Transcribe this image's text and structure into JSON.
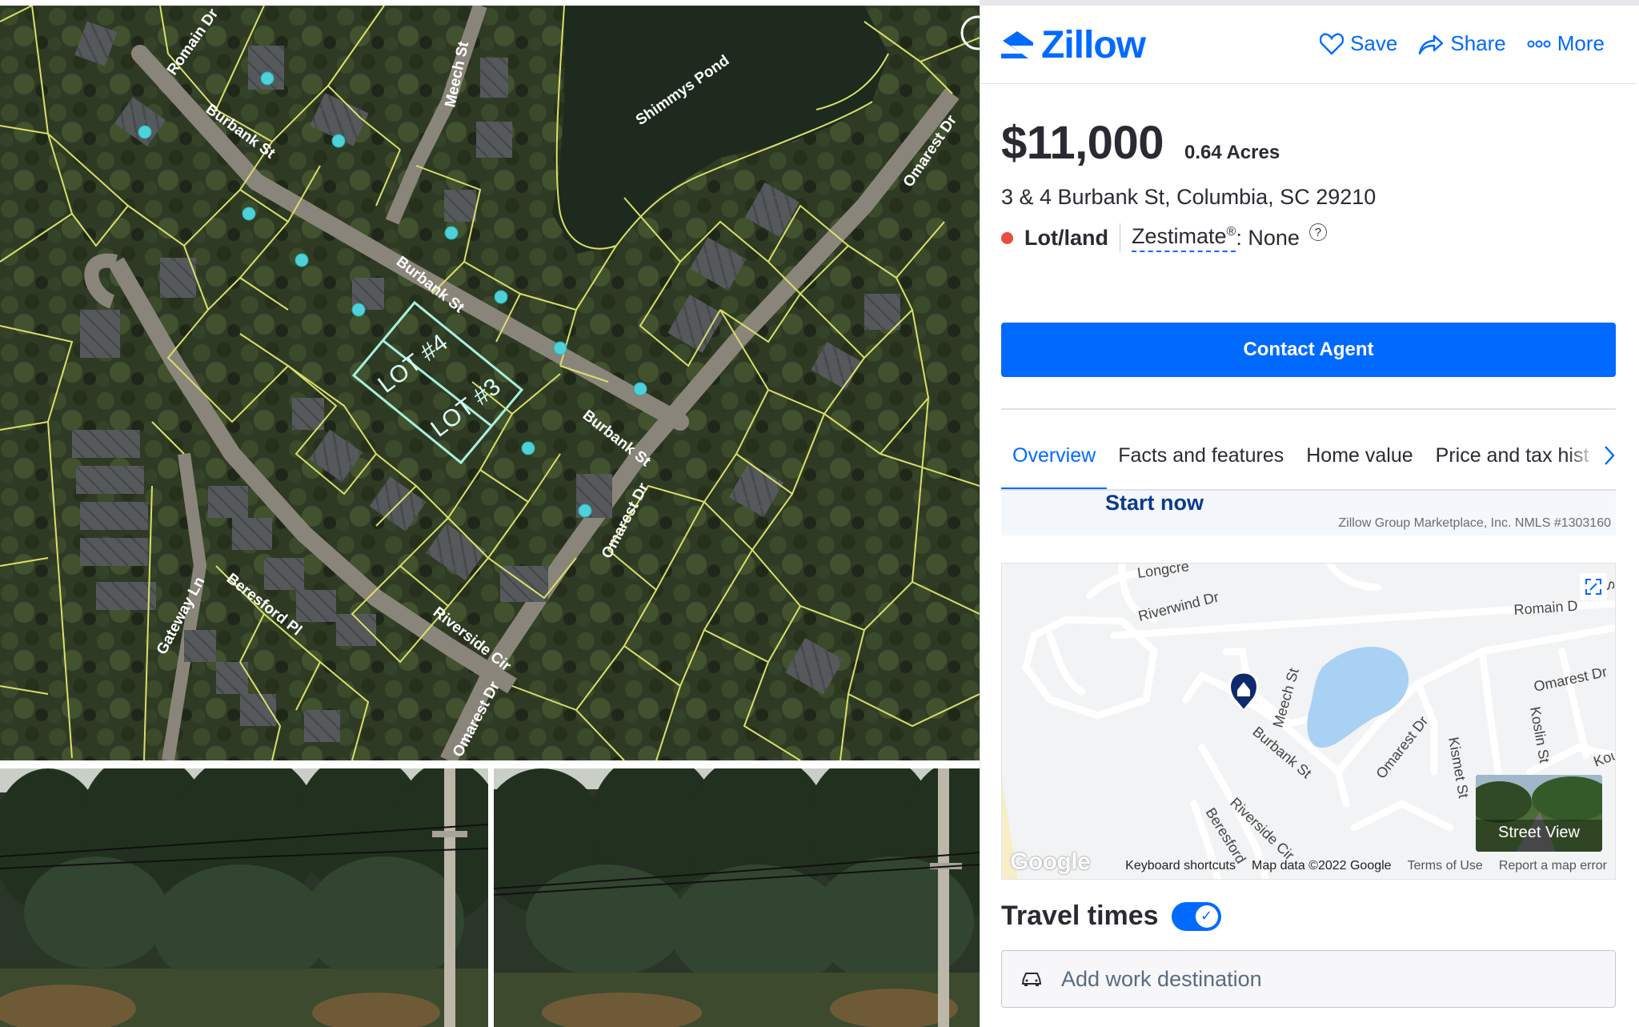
{
  "header": {
    "brand": "Zillow",
    "actions": [
      {
        "label": "Save",
        "icon": "heart-icon"
      },
      {
        "label": "Share",
        "icon": "share-icon"
      },
      {
        "label": "More",
        "icon": "more-icon"
      }
    ]
  },
  "listing": {
    "price": "$11,000",
    "lot_size": "0.64 Acres",
    "address": "3 & 4 Burbank St, Columbia, SC 29210",
    "status_type": "Lot/land",
    "zestimate_label": "Zestimate",
    "zestimate_mark": "®",
    "zestimate_value": ": None",
    "help": "?"
  },
  "contact": {
    "label": "Contact Agent"
  },
  "tabs": [
    {
      "label": "Overview",
      "active": true
    },
    {
      "label": "Facts and features",
      "active": false
    },
    {
      "label": "Home value",
      "active": false
    },
    {
      "label": "Price and tax hist",
      "active": false
    }
  ],
  "promo": {
    "cta": "Start now",
    "note": "Zillow Group Marketplace, Inc. NMLS #1303160"
  },
  "aerial_map": {
    "labels": {
      "shimmys_pond": "Shimmys Pond",
      "romain_dr": "Romain Dr",
      "meech_st": "Meech St",
      "burbank_st_1": "Burbank St",
      "burbank_st_2": "Burbank St",
      "burbank_st_3": "Burbank St",
      "omarest_dr_1": "Omarest Dr",
      "omarest_dr_2": "Omarest Dr",
      "omarest_dr_3": "Omarest Dr",
      "riverside_cir": "Riverside Cir",
      "beresford_pl": "Beresford Pl",
      "gateway_ln": "Gateway Ln",
      "lot_4": "LOT #4",
      "lot_3": "LOT #3"
    }
  },
  "google_map": {
    "streets": {
      "longcreek": "Longcre",
      "riverwind": "Riverwind Dr",
      "romain": "Romain D",
      "omarest1": "Omarest Dr",
      "omarest2": "Omarest Dr",
      "meech": "Meech St",
      "burbank": "Burbank St",
      "kismet": "Kismet St",
      "koslin": "Koslin St",
      "riverside": "Riverside Cir",
      "beresford": "Beresford",
      "koul": "Koul",
      "edge_s": "S"
    },
    "street_view": "Street View",
    "google": "Google",
    "footer": [
      "Keyboard shortcuts",
      "Map data ©2022 Google",
      "Terms of Use",
      "Report a map error"
    ]
  },
  "travel": {
    "title": "Travel times",
    "toggle_on": true,
    "input_placeholder": "Add work destination"
  },
  "colors": {
    "brand_blue": "#006aff",
    "status_red": "#ea4c3d",
    "parcel_lines": "#d8e06a",
    "lot_outline": "#a8f0dc"
  }
}
